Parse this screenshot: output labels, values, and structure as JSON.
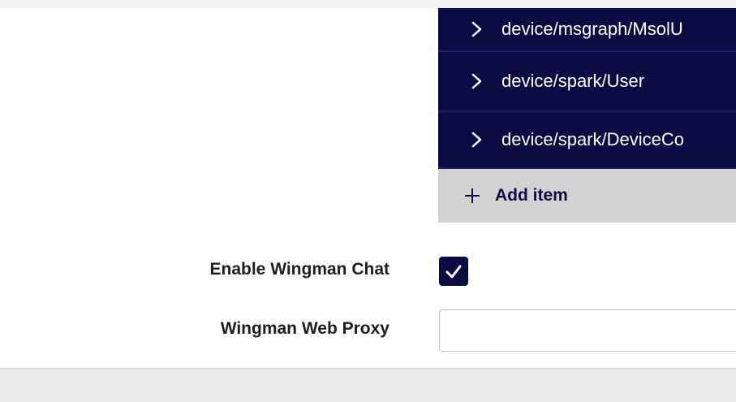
{
  "items_list": {
    "items": [
      {
        "label": "device/msgraph/MsolU"
      },
      {
        "label": "device/spark/User"
      },
      {
        "label": "device/spark/DeviceCo"
      }
    ],
    "add_label": "Add item"
  },
  "settings": {
    "enable_chat_label": "Enable Wingman Chat",
    "enable_chat_checked": true,
    "web_proxy_label": "Wingman Web Proxy",
    "web_proxy_value": ""
  },
  "colors": {
    "accent": "#0b0b44",
    "add_item_bg": "#d2d2d2"
  }
}
